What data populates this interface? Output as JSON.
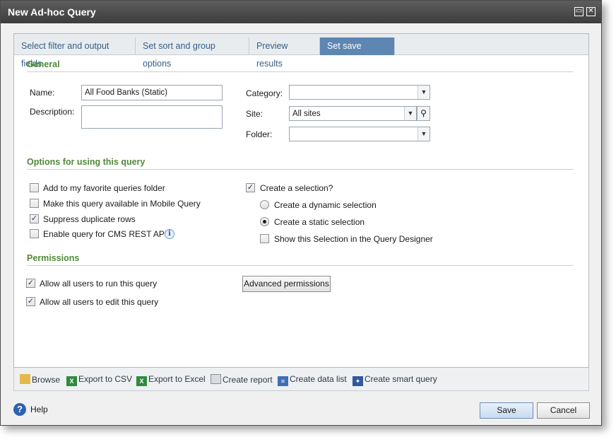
{
  "window": {
    "title": "New Ad-hoc Query",
    "restore_icon": "restore-icon",
    "close_icon": "close-icon"
  },
  "tabs": [
    {
      "label": "Select filter and output fields"
    },
    {
      "label": "Set sort and group options"
    },
    {
      "label": "Preview results"
    },
    {
      "label": "Set save options",
      "active": true
    }
  ],
  "general": {
    "title": "General",
    "name_label": "Name:",
    "name_value": "All Food Banks (Static)",
    "description_label": "Description:",
    "description_value": "",
    "category_label": "Category:",
    "category_value": "",
    "site_label": "Site:",
    "site_value": "All sites",
    "folder_label": "Folder:",
    "folder_value": ""
  },
  "options": {
    "title": "Options for using this query",
    "add_favorites": {
      "label": "Add to my favorite queries folder",
      "checked": false
    },
    "mobile_query": {
      "label": "Make this query available in Mobile Query",
      "checked": false
    },
    "suppress_duplicates": {
      "label": "Suppress duplicate rows",
      "checked": true
    },
    "cms_rest_api": {
      "label": "Enable query for CMS REST API",
      "checked": false
    },
    "create_selection": {
      "label": "Create a selection?",
      "checked": true
    },
    "dynamic_selection": {
      "label": "Create a dynamic selection",
      "selected": false
    },
    "static_selection": {
      "label": "Create a static selection",
      "selected": true
    },
    "show_in_designer": {
      "label": "Show this Selection in the Query Designer",
      "checked": false
    }
  },
  "permissions": {
    "title": "Permissions",
    "run_query": {
      "label": "Allow all users to run this query",
      "checked": true
    },
    "edit_query": {
      "label": "Allow all users to edit this query",
      "checked": true
    },
    "advanced_button": "Advanced permissions"
  },
  "toolbar": {
    "browse": "Browse",
    "export_csv": "Export to CSV",
    "export_excel": "Export to Excel",
    "create_report": "Create report",
    "create_data_list": "Create data list",
    "create_smart_query": "Create smart query"
  },
  "footer": {
    "help_label": "Help",
    "save_label": "Save",
    "cancel_label": "Cancel"
  },
  "colors": {
    "title_bar": "#4a4a4a",
    "active_tab": "#5d86b2",
    "section_title": "#4f8a3a",
    "help_icon": "#2d62b0"
  }
}
